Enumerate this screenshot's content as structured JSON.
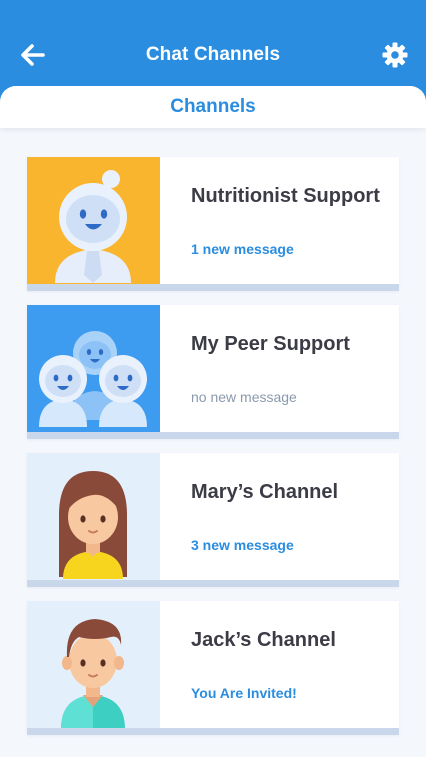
{
  "header": {
    "title": "Chat Channels",
    "back_icon": "arrow-left-icon",
    "settings_icon": "gear-icon"
  },
  "tab": {
    "label": "Channels"
  },
  "colors": {
    "primary": "#2b8de0",
    "card_orange": "#f9b52e",
    "card_blue": "#3d9bf0",
    "card_lightblue": "#e3f0fb"
  },
  "channels": [
    {
      "title": "Nutritionist Support",
      "status": "1 new message",
      "status_style": "blue",
      "avatar": "robot-nutritionist-avatar"
    },
    {
      "title": "My Peer Support",
      "status": "no new message",
      "status_style": "grey",
      "avatar": "robot-group-avatar"
    },
    {
      "title": "Mary’s Channel",
      "status": "3 new message",
      "status_style": "blue",
      "avatar": "woman-avatar"
    },
    {
      "title": "Jack’s Channel",
      "status": "You Are Invited!",
      "status_style": "blue",
      "avatar": "man-avatar"
    }
  ]
}
